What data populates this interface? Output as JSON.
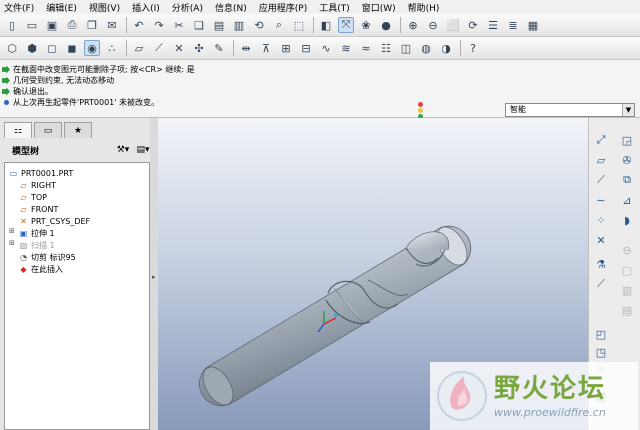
{
  "menu": [
    "文件(F)",
    "编辑(E)",
    "视图(V)",
    "插入(I)",
    "分析(A)",
    "信息(N)",
    "应用程序(P)",
    "工具(T)",
    "窗口(W)",
    "帮助(H)"
  ],
  "messages": [
    {
      "icon": "arrow",
      "text": "在截面中改变图元可能删除子项; 按<CR> 继续:           是"
    },
    {
      "icon": "arrow",
      "text": "几何受到约束, 无法动态移动"
    },
    {
      "icon": "arrow",
      "text": "确认退出。"
    },
    {
      "icon": "dot",
      "text": "从上次再生起零件'PRT0001' 未被改变。"
    }
  ],
  "filter": {
    "value": "智能"
  },
  "navigator": {
    "tree_title": "模型树",
    "items": [
      {
        "label": "PRT0001.PRT",
        "icon": "part-icon",
        "muted": false
      },
      {
        "label": "RIGHT",
        "icon": "datum-plane-icon",
        "muted": false
      },
      {
        "label": "TOP",
        "icon": "datum-plane-icon",
        "muted": false
      },
      {
        "label": "FRONT",
        "icon": "datum-plane-icon",
        "muted": false
      },
      {
        "label": "PRT_CSYS_DEF",
        "icon": "csys-icon",
        "muted": false
      },
      {
        "label": "拉伸 1",
        "icon": "extrude-icon",
        "muted": false
      },
      {
        "label": "扫描 1",
        "icon": "sweep-icon",
        "muted": true
      },
      {
        "label": "切剪 标识95",
        "icon": "cut-icon",
        "muted": false
      },
      {
        "label": "在此插入",
        "icon": "insert-here-icon",
        "muted": false
      }
    ]
  },
  "colors": {
    "accent": "#2563c9",
    "model": "#b9c2cc",
    "background_top": "#f2f4f8",
    "background_bottom": "#8899ba"
  },
  "watermark": {
    "title": "野火论坛",
    "url": "www.proewildfire.cn"
  }
}
